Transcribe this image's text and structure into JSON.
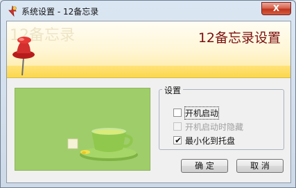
{
  "window": {
    "title": "系统设置 - 12备忘录",
    "close_label": "X"
  },
  "banner": {
    "watermark": "12备忘录",
    "heading": "12备忘录设置"
  },
  "settings": {
    "group_label": "设置",
    "options": [
      {
        "label": "开机启动",
        "checked": false,
        "enabled": true
      },
      {
        "label": "开机启动时隐藏",
        "checked": false,
        "enabled": false
      },
      {
        "label": "最小化到托盘",
        "checked": true,
        "enabled": true
      }
    ]
  },
  "buttons": {
    "ok": "确 定",
    "cancel": "取 消"
  },
  "colors": {
    "banner_yellow": "#ffe27a",
    "heading_red": "#7a0f0f",
    "photo_green": "#9ccb68"
  }
}
